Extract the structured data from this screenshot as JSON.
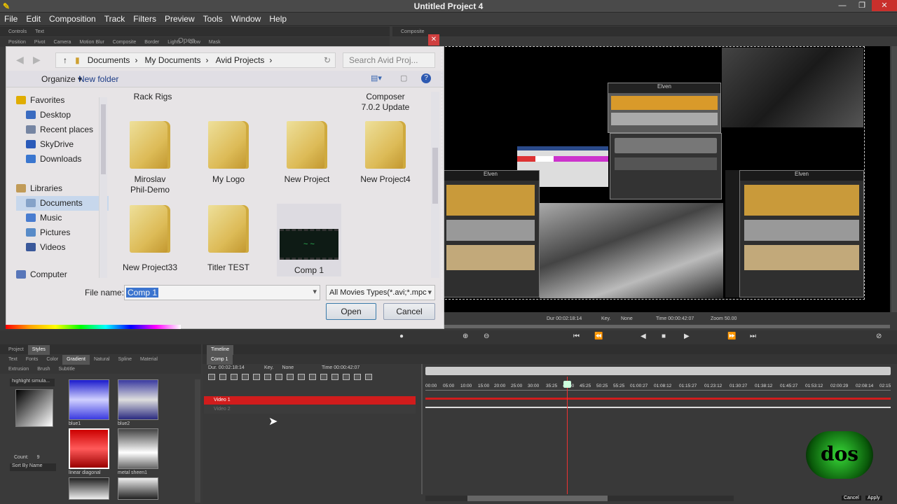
{
  "app": {
    "title": "Untitled Project 4",
    "accent": "#e31e24"
  },
  "menu": [
    "File",
    "Edit",
    "Composition",
    "Track",
    "Filters",
    "Preview",
    "Tools",
    "Window",
    "Help"
  ],
  "panels": {
    "controls_tabs": [
      "Controls",
      "Text"
    ],
    "dialog_title": "Open",
    "composite": "Composite",
    "sub_tabs": [
      "Position",
      "Pivot",
      "Camera",
      "Motion Blur",
      "Composite",
      "Border",
      "Lights",
      "Glow",
      "Mask"
    ]
  },
  "dialog": {
    "breadcrumb": [
      "Documents",
      "My Documents",
      "Avid Projects"
    ],
    "search_placeholder": "Search Avid Proj...",
    "organize": "Organize",
    "new_folder": "New folder",
    "nav": {
      "favorites": "Favorites",
      "items": [
        "Desktop",
        "Recent places",
        "SkyDrive",
        "Downloads"
      ],
      "libraries": "Libraries",
      "lib_items": [
        "Documents",
        "Music",
        "Pictures",
        "Videos"
      ],
      "computer": "Computer"
    },
    "partial_labels": [
      "Rack Rigs",
      "Composer\n7.0.2 Update"
    ],
    "files": [
      {
        "name": "Miroslav\nPhil-Demo"
      },
      {
        "name": "My Logo"
      },
      {
        "name": "New Project"
      },
      {
        "name": "New Project4"
      },
      {
        "name": "New Project33"
      },
      {
        "name": "Titler TEST"
      },
      {
        "name": "Comp 1"
      }
    ],
    "filename_label": "File name:",
    "filename_value": "Comp 1",
    "filetype": "All Movies Types(*.avi;*.mpc",
    "open": "Open",
    "cancel": "Cancel"
  },
  "viewer_info": {
    "dur_label": "Dur",
    "dur": "00:02:18:14",
    "key_label": "Key.",
    "key": "None",
    "time_label": "Time",
    "time": "00:00:42:07",
    "zoom_label": "Zoom",
    "zoom": "50.00"
  },
  "left_panel": {
    "tabs": [
      "Project",
      "Styles"
    ],
    "sub_tabs": [
      "Text",
      "Fonts",
      "Color",
      "Gradient",
      "Natural",
      "Spline",
      "Material"
    ],
    "sub_tabs2": [
      "Extrusion",
      "Brush",
      "Subtitle"
    ],
    "selected": "highlight simula...",
    "count_label": "Count:",
    "count": "9",
    "sort": "Sort By Name",
    "swatches": [
      "blue1",
      "blue2",
      "linear diagonal",
      "metal sheen1",
      "",
      ""
    ]
  },
  "timeline": {
    "tab": "Timeline",
    "comp": "Comp 1",
    "dur_label": "Dur.",
    "dur": "00:02:18:14",
    "key_label": "Key.",
    "key": "None",
    "time_label": "Time",
    "time": "00:00:42:07",
    "tracks": [
      "Video 1",
      "Video 2"
    ],
    "ruler": [
      "00:00",
      "05:00",
      "10:00",
      "15:00",
      "20:00",
      "25:00",
      "30:00",
      "35:25",
      "40:00",
      "45:25",
      "50:25",
      "55:25",
      "01:00:27",
      "01:08:12",
      "01:15:27",
      "01:23:12",
      "01:30:27",
      "01:38:12",
      "01:45:27",
      "01:53:12",
      "02:00:29",
      "02:08:14",
      "02:15"
    ],
    "cancel": "Cancel",
    "apply": "Apply"
  }
}
